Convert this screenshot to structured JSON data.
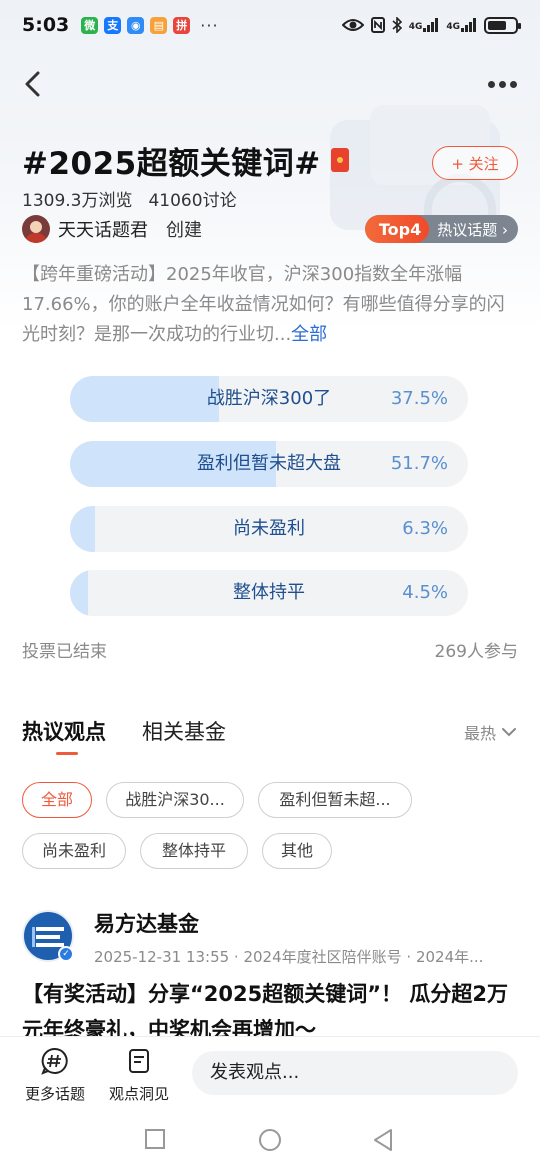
{
  "status_bar": {
    "time": "5:03",
    "apps": [
      {
        "icon": "wechat-icon",
        "color": "#2bb24c",
        "glyph": "微"
      },
      {
        "icon": "alipay-icon",
        "color": "#1677ff",
        "glyph": "支"
      },
      {
        "icon": "message-icon",
        "color": "#2f8cf5",
        "glyph": "◉"
      },
      {
        "icon": "book-icon",
        "color": "#f6a23a",
        "glyph": "▤"
      },
      {
        "icon": "shopping-icon",
        "color": "#e8463c",
        "glyph": "拼"
      }
    ],
    "more": "···",
    "network_1": "4G",
    "network_2": "4G"
  },
  "topic": {
    "title": "#2025超额关键词#",
    "follow_label": "+ 关注",
    "views": "1309.3万浏览",
    "discussions": "41060讨论",
    "creator_name": "天天话题君",
    "creator_action": "创建",
    "hot_rank": "Top4",
    "hot_label": "热议话题 ›",
    "description": "【跨年重磅活动】2025年收官，沪深300指数全年涨幅17.66%，你的账户全年收益情况如何？有哪些值得分享的闪光时刻？是那一次成功的行业切...",
    "description_more": "全部"
  },
  "poll": {
    "options": [
      {
        "label": "战胜沪深300了",
        "percent_label": "37.5%",
        "percent": 37.5
      },
      {
        "label": "盈利但暂未超大盘",
        "percent_label": "51.7%",
        "percent": 51.7
      },
      {
        "label": "尚未盈利",
        "percent_label": "6.3%",
        "percent": 6.3
      },
      {
        "label": "整体持平",
        "percent_label": "4.5%",
        "percent": 4.5
      }
    ],
    "status": "投票已结束",
    "participants": "269人参与"
  },
  "tabs": {
    "active": "热议观点",
    "other": "相关基金",
    "sort": "最热"
  },
  "filters": [
    "全部",
    "战胜沪深30...",
    "盈利但暂未超...",
    "尚未盈利",
    "整体持平",
    "其他"
  ],
  "post": {
    "author": "易方达基金",
    "meta": "2025-12-31 13:55 · 2024年度社区陪伴账号 · 2024年...",
    "title": "【有奖活动】分享“2025超额关键词”！ 瓜分超2万元年终豪礼，中奖机会再增加～"
  },
  "bottom_bar": {
    "more_topics": "更多话题",
    "insights": "观点洞见",
    "comment_placeholder": "发表观点..."
  },
  "colors": {
    "accent": "#f05a3c",
    "poll_fill": "#cfe3fb",
    "poll_text": "#1f4f8f",
    "link": "#2b6cd6"
  }
}
